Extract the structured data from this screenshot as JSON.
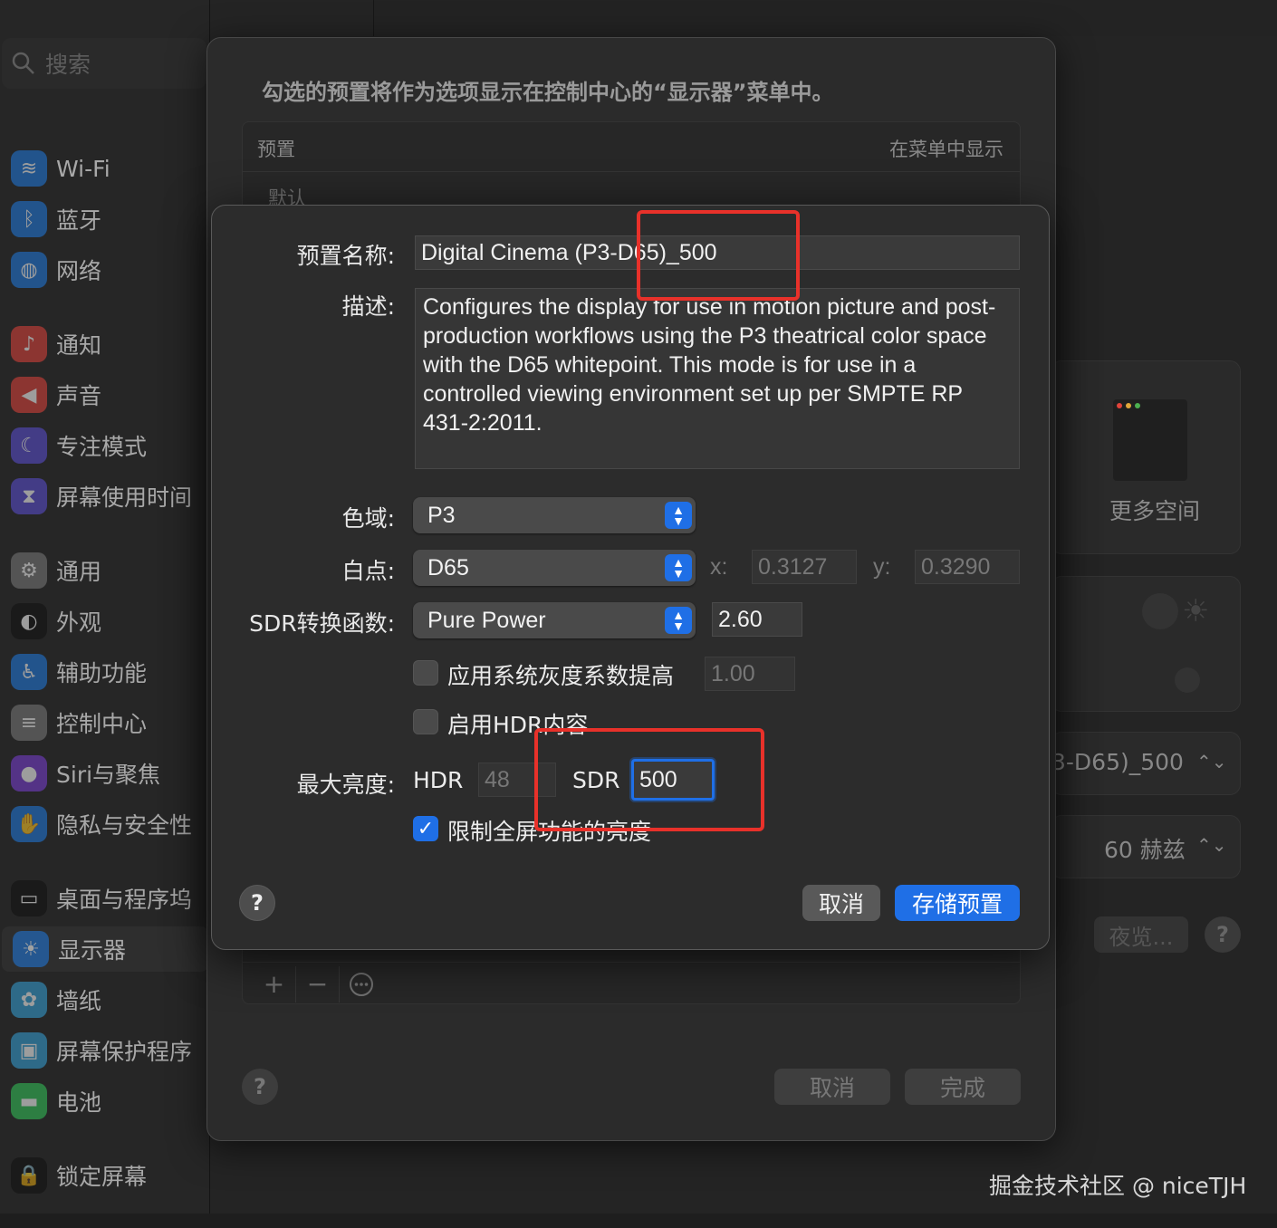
{
  "sidebar": {
    "search_placeholder": "搜索",
    "items": [
      {
        "label": "Wi-Fi",
        "icon": "wifi-icon",
        "color": "#1f7ae0"
      },
      {
        "label": "蓝牙",
        "icon": "bluetooth-icon",
        "color": "#1f7ae0"
      },
      {
        "label": "网络",
        "icon": "globe-icon",
        "color": "#1f7ae0"
      },
      {
        "label": "通知",
        "icon": "bell-icon",
        "color": "#e0433a"
      },
      {
        "label": "声音",
        "icon": "speaker-icon",
        "color": "#e0433a"
      },
      {
        "label": "专注模式",
        "icon": "moon-icon",
        "color": "#5b4fd6"
      },
      {
        "label": "屏幕使用时间",
        "icon": "hourglass-icon",
        "color": "#5b4fd6"
      },
      {
        "label": "通用",
        "icon": "gear-icon",
        "color": "#7a7a7a"
      },
      {
        "label": "外观",
        "icon": "appearance-icon",
        "color": "#111111"
      },
      {
        "label": "辅助功能",
        "icon": "accessibility-icon",
        "color": "#1f7ae0"
      },
      {
        "label": "控制中心",
        "icon": "control-center-icon",
        "color": "#7a7a7a"
      },
      {
        "label": "Siri与聚焦",
        "icon": "siri-icon",
        "color": "#7a3fd6"
      },
      {
        "label": "隐私与安全性",
        "icon": "hand-icon",
        "color": "#1f7ae0"
      },
      {
        "label": "桌面与程序坞",
        "icon": "dock-icon",
        "color": "#111111"
      },
      {
        "label": "显示器",
        "icon": "sun-icon",
        "color": "#1f7ae0"
      },
      {
        "label": "墙纸",
        "icon": "flower-icon",
        "color": "#36a3d9"
      },
      {
        "label": "屏幕保护程序",
        "icon": "screensaver-icon",
        "color": "#36a3d9"
      },
      {
        "label": "电池",
        "icon": "battery-icon",
        "color": "#34c759"
      },
      {
        "label": "锁定屏幕",
        "icon": "lock-icon",
        "color": "#111111"
      }
    ]
  },
  "background_right": {
    "more_space": "更多空间",
    "preset_value": "3-D65)_500",
    "refresh_rate": "60 赫兹",
    "night_shift": "夜览..."
  },
  "presets_sheet": {
    "description": "勾选的预置将作为选项显示在控制中心的“显示器”菜单中。",
    "column_preset": "预置",
    "column_show_in_menu": "在菜单中显示",
    "default_row": "默认",
    "add": "+",
    "remove": "−",
    "more": "⋯",
    "help": "?",
    "cancel": "取消",
    "done": "完成"
  },
  "dialog": {
    "preset_name_label": "预置名称:",
    "preset_name": "Digital Cinema (P3-D65)_500",
    "description_label": "描述:",
    "description": "Configures the display for use in motion picture and post-production workflows using the P3 theatrical color space with the D65 whitepoint. This mode is for use in a controlled viewing environment set up per SMPTE RP 431-2:2011.",
    "gamut_label": "色域:",
    "gamut": "P3",
    "white_point_label": "白点:",
    "white_point": "D65",
    "x_label": "x:",
    "x_value": "0.3127",
    "y_label": "y:",
    "y_value": "0.3290",
    "sdr_transfer_label": "SDR转换函数:",
    "sdr_transfer": "Pure Power",
    "gamma": "2.60",
    "system_gamma_boost_label": "应用系统灰度系数提高",
    "system_gamma_boost_checked": false,
    "system_gamma_boost_value": "1.00",
    "enable_hdr_label": "启用HDR内容",
    "enable_hdr_checked": false,
    "max_brightness_label": "最大亮度:",
    "hdr_label": "HDR",
    "hdr_value": "48",
    "sdr_label": "SDR",
    "sdr_value": "500",
    "limit_fullscreen_label": "限制全屏功能的亮度",
    "limit_fullscreen_checked": true,
    "help": "?",
    "cancel": "取消",
    "save": "存储预置"
  },
  "watermark": "掘金技术社区 @ niceTJH",
  "colors": {
    "accent": "#1f6fe6",
    "annotation_red": "#e8312a"
  }
}
